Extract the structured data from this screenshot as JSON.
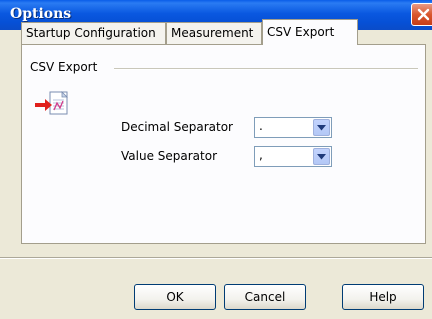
{
  "window": {
    "title": "Options"
  },
  "tabs": [
    {
      "label": "Startup Configuration",
      "active": false
    },
    {
      "label": "Measurement",
      "active": false
    },
    {
      "label": "CSV Export",
      "active": true
    }
  ],
  "csv_export": {
    "group_label": "CSV Export",
    "icon": "csv-export-icon",
    "decimal_separator": {
      "label": "Decimal Separator",
      "value": "."
    },
    "value_separator": {
      "label": "Value Separator",
      "value": ","
    }
  },
  "buttons": {
    "ok": "OK",
    "cancel": "Cancel",
    "help": "Help"
  },
  "colors": {
    "titlebar": "#0a5de8",
    "close": "#d9572e",
    "arrow": "#e0201c"
  }
}
